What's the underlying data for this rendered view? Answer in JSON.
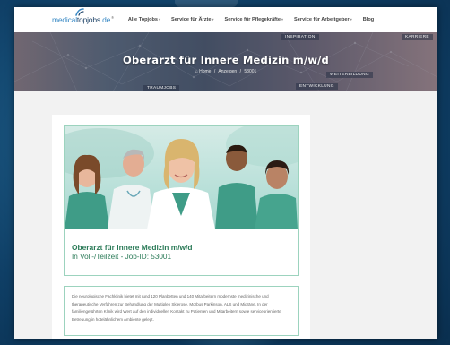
{
  "logo": {
    "part1": "medical",
    "part2": "topjobs",
    "suffix": ".de",
    "sup": "®"
  },
  "nav": {
    "items": [
      {
        "label": "Alle Topjobs",
        "has_dropdown": true
      },
      {
        "label": "Service für Ärzte",
        "has_dropdown": true
      },
      {
        "label": "Service für Pflegekräfte",
        "has_dropdown": true
      },
      {
        "label": "Service für Arbeitgeber",
        "has_dropdown": true
      },
      {
        "label": "Blog",
        "has_dropdown": false
      }
    ],
    "chevron": "▾"
  },
  "hero": {
    "title": "Oberarzt für Innere Medizin m/w/d",
    "breadcrumb": {
      "home_icon": "⌂",
      "home": "Home",
      "sep": "/",
      "section": "Anzeigen",
      "id": "53001"
    },
    "tags": [
      "INSPIRATION",
      "KARRIERE",
      "WEITERBILDUNG",
      "ENTWICKLUNG",
      "TRAUMJOBS"
    ]
  },
  "job": {
    "title": "Oberarzt für Innere Medizin m/w/d",
    "subtitle": "In Voll-/Teilzeit - Job-ID: 53001",
    "description": "Die neurologische Fachklinik bietet mit rund 120 Planbetten und 140 Mitarbeitern modernste medizinische und therapeutische Verfahren zur Behandlung der Multiplen Sklerose, Morbus Parkinson, ALS und Migräne. In der familiengeführten Klinik wird Wert auf den individuellen Kontakt zu Patienten und Mitarbeitern sowie serviceorientierte Betreuung in hotelähnlichem Ambiente gelegt."
  },
  "colors": {
    "brand_blue": "#3a8ac5",
    "brand_dark": "#23476b",
    "job_green": "#2a7a57",
    "card_border": "#9cd3be"
  }
}
